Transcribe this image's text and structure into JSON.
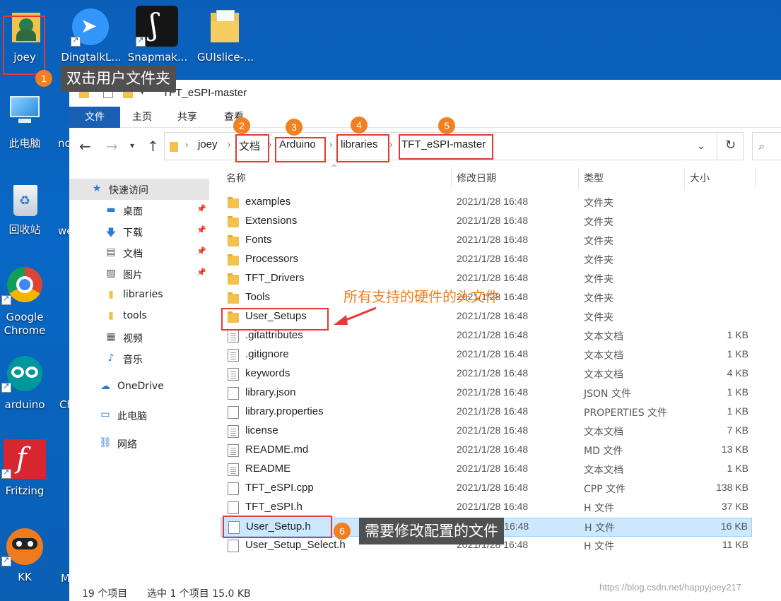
{
  "desktop": {
    "icons": [
      {
        "label": "joey"
      },
      {
        "label": "DingtalkL..."
      },
      {
        "label": "Snapmak..."
      },
      {
        "label": "GUIslice-..."
      },
      {
        "label": "此电脑"
      },
      {
        "label": "nc"
      },
      {
        "label": "回收站"
      },
      {
        "label": "we"
      },
      {
        "label": "Google Chrome"
      },
      {
        "label": "arduino"
      },
      {
        "label": "Ch"
      },
      {
        "label": "Fritzing"
      },
      {
        "label": "KK"
      },
      {
        "label": "M"
      }
    ]
  },
  "window": {
    "title": "TFT_eSPI-master",
    "ribbon_tabs": [
      "文件",
      "主页",
      "共享",
      "查看"
    ],
    "breadcrumb": [
      "joey",
      "文档",
      "Arduino",
      "libraries",
      "TFT_eSPI-master"
    ],
    "refresh_icon": "↻",
    "search_icon": "⌕"
  },
  "nav": [
    {
      "label": "快速访问",
      "icon": "star-icon"
    },
    {
      "label": "桌面",
      "icon": "desktop-icon",
      "pinned": true
    },
    {
      "label": "下载",
      "icon": "download-icon",
      "pinned": true
    },
    {
      "label": "文档",
      "icon": "document-icon",
      "pinned": true
    },
    {
      "label": "图片",
      "icon": "picture-icon",
      "pinned": true
    },
    {
      "label": "libraries",
      "icon": "folder-icon"
    },
    {
      "label": "tools",
      "icon": "folder-icon"
    },
    {
      "label": "视频",
      "icon": "video-icon"
    },
    {
      "label": "音乐",
      "icon": "music-icon"
    },
    {
      "label": "OneDrive",
      "icon": "cloud-icon"
    },
    {
      "label": "此电脑",
      "icon": "computer-icon"
    },
    {
      "label": "网络",
      "icon": "network-icon"
    }
  ],
  "columns": {
    "name": "名称",
    "date": "修改日期",
    "type": "类型",
    "size": "大小"
  },
  "files": [
    {
      "name": "examples",
      "date": "2021/1/28 16:48",
      "type": "文件夹",
      "size": "",
      "kind": "folder"
    },
    {
      "name": "Extensions",
      "date": "2021/1/28 16:48",
      "type": "文件夹",
      "size": "",
      "kind": "folder"
    },
    {
      "name": "Fonts",
      "date": "2021/1/28 16:48",
      "type": "文件夹",
      "size": "",
      "kind": "folder"
    },
    {
      "name": "Processors",
      "date": "2021/1/28 16:48",
      "type": "文件夹",
      "size": "",
      "kind": "folder"
    },
    {
      "name": "TFT_Drivers",
      "date": "2021/1/28 16:48",
      "type": "文件夹",
      "size": "",
      "kind": "folder"
    },
    {
      "name": "Tools",
      "date": "2021/1/28 16:48",
      "type": "文件夹",
      "size": "",
      "kind": "folder"
    },
    {
      "name": "User_Setups",
      "date": "2021/1/28 16:48",
      "type": "文件夹",
      "size": "",
      "kind": "folder"
    },
    {
      "name": ".gitattributes",
      "date": "2021/1/28 16:48",
      "type": "文本文档",
      "size": "1 KB",
      "kind": "doc"
    },
    {
      "name": ".gitignore",
      "date": "2021/1/28 16:48",
      "type": "文本文档",
      "size": "1 KB",
      "kind": "doc"
    },
    {
      "name": "keywords",
      "date": "2021/1/28 16:48",
      "type": "文本文档",
      "size": "4 KB",
      "kind": "doc"
    },
    {
      "name": "library.json",
      "date": "2021/1/28 16:48",
      "type": "JSON 文件",
      "size": "1 KB",
      "kind": "plain"
    },
    {
      "name": "library.properties",
      "date": "2021/1/28 16:48",
      "type": "PROPERTIES 文件",
      "size": "1 KB",
      "kind": "plain"
    },
    {
      "name": "license",
      "date": "2021/1/28 16:48",
      "type": "文本文档",
      "size": "7 KB",
      "kind": "doc"
    },
    {
      "name": "README.md",
      "date": "2021/1/28 16:48",
      "type": "MD 文件",
      "size": "13 KB",
      "kind": "doc"
    },
    {
      "name": "README",
      "date": "2021/1/28 16:48",
      "type": "文本文档",
      "size": "1 KB",
      "kind": "doc"
    },
    {
      "name": "TFT_eSPI.cpp",
      "date": "2021/1/28 16:48",
      "type": "CPP 文件",
      "size": "138 KB",
      "kind": "plain"
    },
    {
      "name": "TFT_eSPI.h",
      "date": "2021/1/28 16:48",
      "type": "H 文件",
      "size": "37 KB",
      "kind": "plain"
    },
    {
      "name": "User_Setup.h",
      "date": "2021/1/28 16:48",
      "type": "H 文件",
      "size": "16 KB",
      "kind": "plain",
      "selected": true
    },
    {
      "name": "User_Setup_Select.h",
      "date": "2021/1/28 16:48",
      "type": "H 文件",
      "size": "11 KB",
      "kind": "plain"
    }
  ],
  "status": {
    "count": "19 个项目",
    "selection": "选中 1 个项目 15.0 KB"
  },
  "watermark": "https://blog.csdn.net/happyjoey217",
  "annotations": {
    "badges": [
      "1",
      "2",
      "3",
      "4",
      "5",
      "6"
    ],
    "tip1": "双击用户文件夹",
    "tip6": "需要修改配置的文件",
    "headers_note": "所有支持的硬件的头文件"
  },
  "colors": {
    "accent": "#1a5fb4",
    "annotation_red": "#e53935",
    "badge_orange": "#f08021",
    "selection": "#cce8ff"
  }
}
